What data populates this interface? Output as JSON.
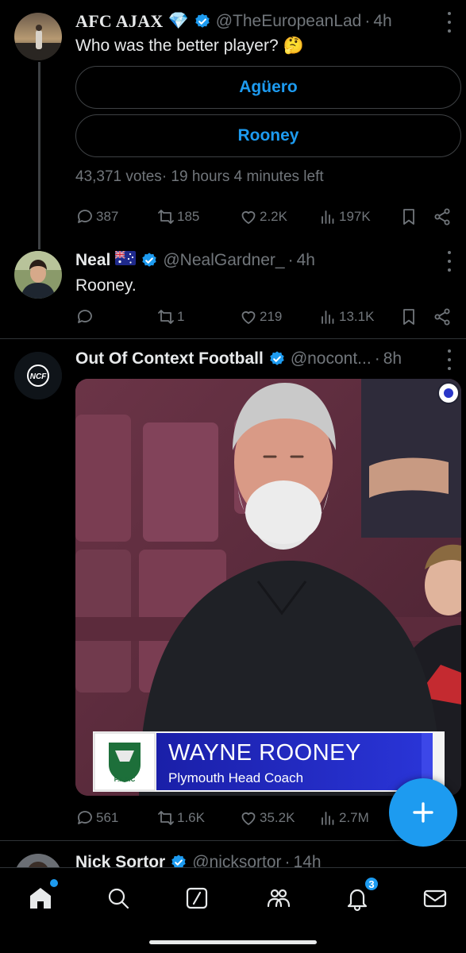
{
  "tweets": [
    {
      "name": "AFC AJAX",
      "emoji": "💎",
      "handle": "@TheEuropeanLad",
      "time": "4h",
      "text": "Who was the better player? 🤔",
      "poll": {
        "options": [
          "Agüero",
          "Rooney"
        ],
        "votes": "43,371 votes",
        "time_left": "19 hours 4 minutes left"
      },
      "replies": "387",
      "retweets": "185",
      "likes": "2.2K",
      "views": "197K"
    },
    {
      "name": "Neal",
      "flag": "🇦🇺",
      "handle": "@NealGardner_",
      "time": "4h",
      "text": "Rooney.",
      "replies": "",
      "retweets": "1",
      "likes": "219",
      "views": "13.1K"
    },
    {
      "name": "Out Of Context Football",
      "handle": "@nocont...",
      "time": "8h",
      "avatar_label": "NCF",
      "media": {
        "caption_name": "WAYNE ROONEY",
        "caption_role": "Plymouth Head Coach",
        "crest_label": "P.A.F.C"
      },
      "replies": "561",
      "retweets": "1.6K",
      "likes": "35.2K",
      "views": "2.7M"
    },
    {
      "name": "Nick Sortor",
      "handle": "@nicksortor",
      "time": "14h"
    }
  ],
  "nav": {
    "notifications_badge": "3"
  },
  "colors": {
    "accent": "#1d9bf0",
    "background": "#000000",
    "secondary_text": "#71767b"
  }
}
